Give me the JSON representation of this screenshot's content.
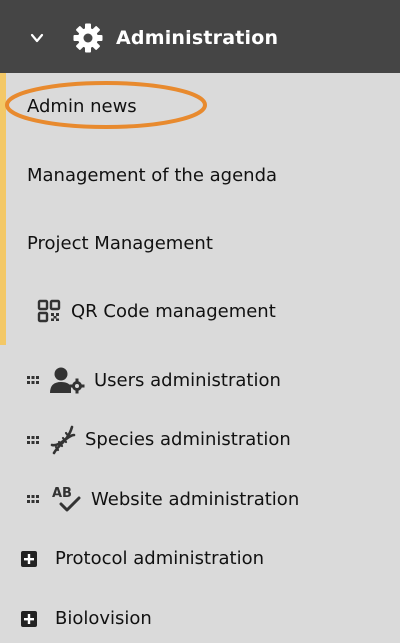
{
  "header": {
    "title": "Administration",
    "chevron_icon": "chevron-down-icon",
    "gear_icon": "gear-icon",
    "background": "#454545"
  },
  "menu": {
    "items": [
      {
        "label": "Admin news",
        "highlighted": true
      },
      {
        "label": "Management of the agenda"
      },
      {
        "label": "Project Management"
      },
      {
        "label": "QR Code management",
        "icon": "qr-code-icon"
      },
      {
        "label": "Users administration",
        "icon": "users-gear-icon",
        "handle": "drag-handle-icon"
      },
      {
        "label": "Species administration",
        "icon": "dna-icon",
        "handle": "drag-handle-icon"
      },
      {
        "label": "Website administration",
        "icon": "spellcheck-icon",
        "handle": "drag-handle-icon"
      },
      {
        "label": "Protocol administration",
        "icon": "plus-square-icon"
      },
      {
        "label": "Biolovision",
        "icon": "plus-square-icon"
      }
    ]
  },
  "colors": {
    "accent": "#f3c867",
    "highlight_ring": "#e88a2e",
    "panel_background": "#dadada"
  }
}
